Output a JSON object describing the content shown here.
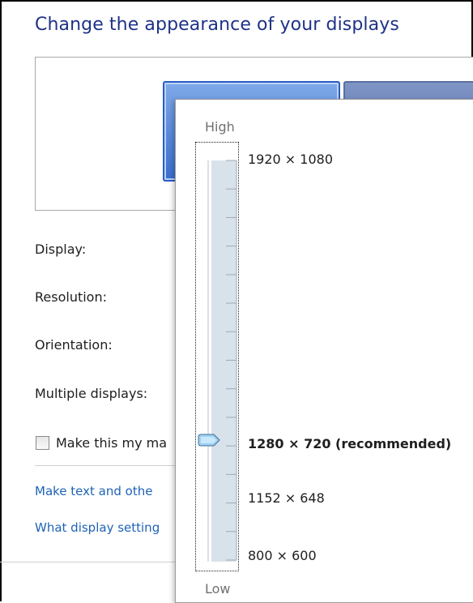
{
  "page": {
    "title": "Change the appearance of your displays"
  },
  "form": {
    "display_label": "Display:",
    "resolution_label": "Resolution:",
    "orientation_label": "Orientation:",
    "multiple_label": "Multiple displays:",
    "checkbox_label": "Make this my ma",
    "checkbox_checked": false
  },
  "links": {
    "text_size": "Make text and othe",
    "settings_help": "What display setting"
  },
  "resolution_popup": {
    "high_label": "High",
    "low_label": "Low",
    "options": [
      {
        "label": "1920 × 1080",
        "bold": false
      },
      {
        "label": "1280 × 720 (recommended)",
        "bold": true,
        "selected": true
      },
      {
        "label": "1152 × 648",
        "bold": false
      },
      {
        "label": "800 × 600",
        "bold": false
      }
    ],
    "tick_count": 15
  },
  "colors": {
    "title": "#1e3287",
    "link": "#1e63b6",
    "track_fill": "#d8e2ea",
    "thumb": "#9fd0f2"
  }
}
